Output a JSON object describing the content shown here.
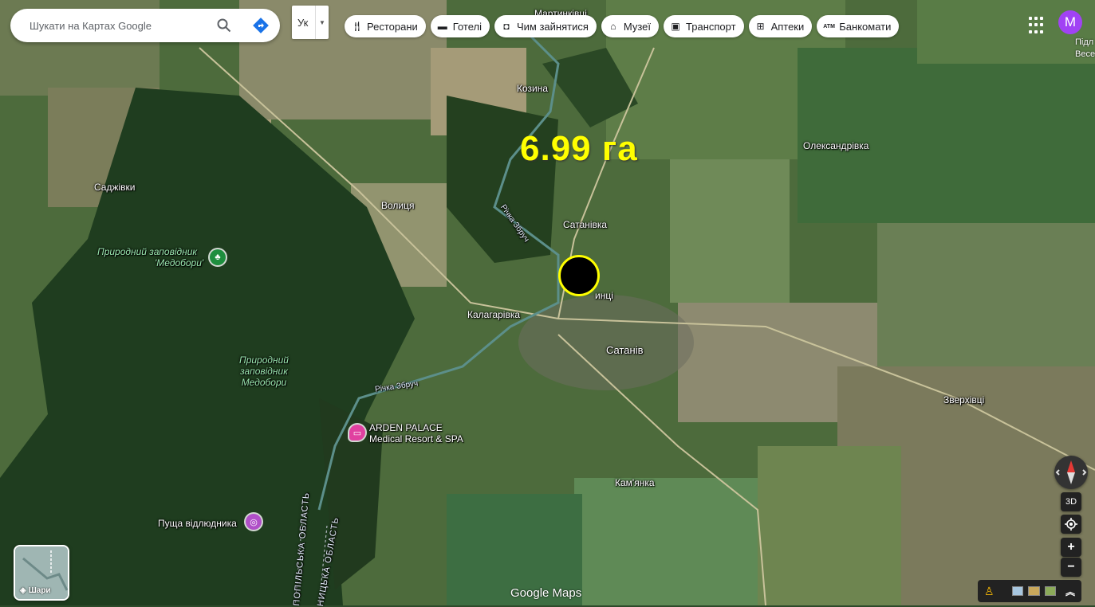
{
  "search": {
    "placeholder": "Шукати на Картах Google"
  },
  "language": {
    "label": "Ук"
  },
  "chips": [
    {
      "label": "Ресторани",
      "icon": "fork-knife-icon"
    },
    {
      "label": "Готелі",
      "icon": "bed-icon"
    },
    {
      "label": "Чим зайнятися",
      "icon": "camera-icon"
    },
    {
      "label": "Музеї",
      "icon": "museum-icon"
    },
    {
      "label": "Транспорт",
      "icon": "bus-icon"
    },
    {
      "label": "Аптеки",
      "icon": "pharmacy-icon"
    },
    {
      "label": "Банкомати",
      "icon": "atm-icon"
    }
  ],
  "account": {
    "avatar_letter": "M",
    "avatar_color": "#a142f4"
  },
  "corner_text": [
    "Підл",
    "Весе"
  ],
  "overlay": {
    "area_text": "6.99 га",
    "text_color": "#ffff00",
    "marker_color": "#000000",
    "marker_ring": "#ffff00"
  },
  "places": {
    "martynkivtsi": "Мартинківці",
    "kozyna": "Козина",
    "oleksandrivka": "Олександрівка",
    "sadzhivky": "Саджівки",
    "volytsia": "Волиця",
    "satanivka": "Сатанівка",
    "reserve1_line1": "Природний заповідник",
    "reserve1_line2": "'Медобори'",
    "lyntsi": "инці",
    "kalaharivka": "Калагарівка",
    "satanov": "Сатанів",
    "reserve2_line1": "Природний",
    "reserve2_line2": "заповідник",
    "reserve2_line3": "Медобори",
    "zverkhivtsi": "Зверхівці",
    "river_zbruch_1": "Річка Збруч",
    "river_zbruch_2": "Річка Збруч",
    "arden_line1": "ARDEN PALACE",
    "arden_line2": "Medical Resort & SPA",
    "kamianka": "Кам'янка",
    "pushcha": "Пуща відлюдника",
    "region1": "ПОПІЛЬСЬКА ОБЛАСТЬ",
    "region2": "НИЦЬКА ОБЛАСТЬ"
  },
  "layers": {
    "label": "Шари"
  },
  "controls": {
    "three_d": "3D",
    "zoom_in": "+",
    "zoom_out": "−"
  },
  "branding": {
    "logo": "Google Maps"
  }
}
